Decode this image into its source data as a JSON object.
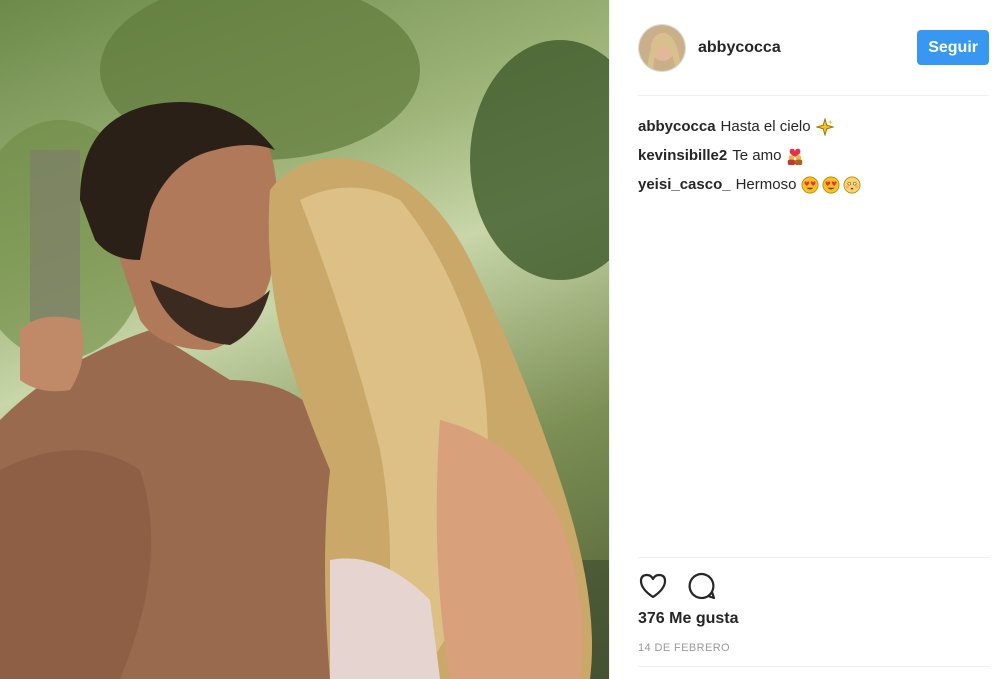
{
  "post": {
    "username": "abbycocca",
    "follow_label": "Seguir",
    "comments": [
      {
        "author": "abbycocca",
        "text": "Hasta el cielo",
        "emojis": [
          "sparkle-star"
        ]
      },
      {
        "author": "kevinsibille2",
        "text": "Te amo",
        "emojis": [
          "couple-heart"
        ]
      },
      {
        "author": "yeisi_casco_",
        "text": "Hermoso",
        "emojis": [
          "heart-eyes",
          "heart-eyes",
          "flushed"
        ]
      }
    ],
    "likes": "376 Me gusta",
    "date": "14 DE FEBRERO"
  },
  "icons": {
    "like": "heart-outline-icon",
    "comment": "comment-bubble-icon"
  },
  "colors": {
    "follow_button": "#3897f0",
    "text": "#262626",
    "muted": "#999999"
  }
}
